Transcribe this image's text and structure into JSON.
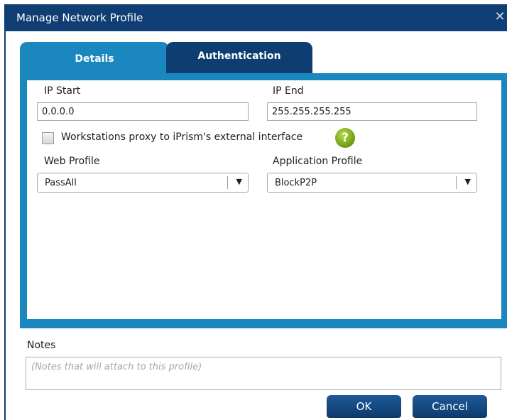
{
  "window": {
    "title": "Manage Network Profile",
    "close_glyph": "✕"
  },
  "tabs": [
    {
      "label": "Details",
      "active": true
    },
    {
      "label": "Authentication",
      "active": false
    }
  ],
  "details": {
    "ip_start": {
      "label": "IP Start",
      "value": "0.0.0.0"
    },
    "ip_end": {
      "label": "IP End",
      "value": "255.255.255.255"
    },
    "proxy_checkbox": {
      "label": "Workstations proxy to iPrism's external interface",
      "checked": false
    },
    "help_glyph": "?",
    "web_profile": {
      "label": "Web Profile",
      "selected": "PassAll"
    },
    "application_profile": {
      "label": "Application Profile",
      "selected": "BlockP2P"
    },
    "dropdown_glyph": "▼"
  },
  "notes": {
    "label": "Notes",
    "placeholder": "(Notes that will attach to this profile)"
  },
  "buttons": {
    "ok": "OK",
    "cancel": "Cancel"
  },
  "colors": {
    "titlebar": "#0f3e74",
    "active_tab": "#1b87bf",
    "inactive_tab": "#0e3d72",
    "button": "#0d3a6c",
    "help_icon": "#6d9a10"
  }
}
